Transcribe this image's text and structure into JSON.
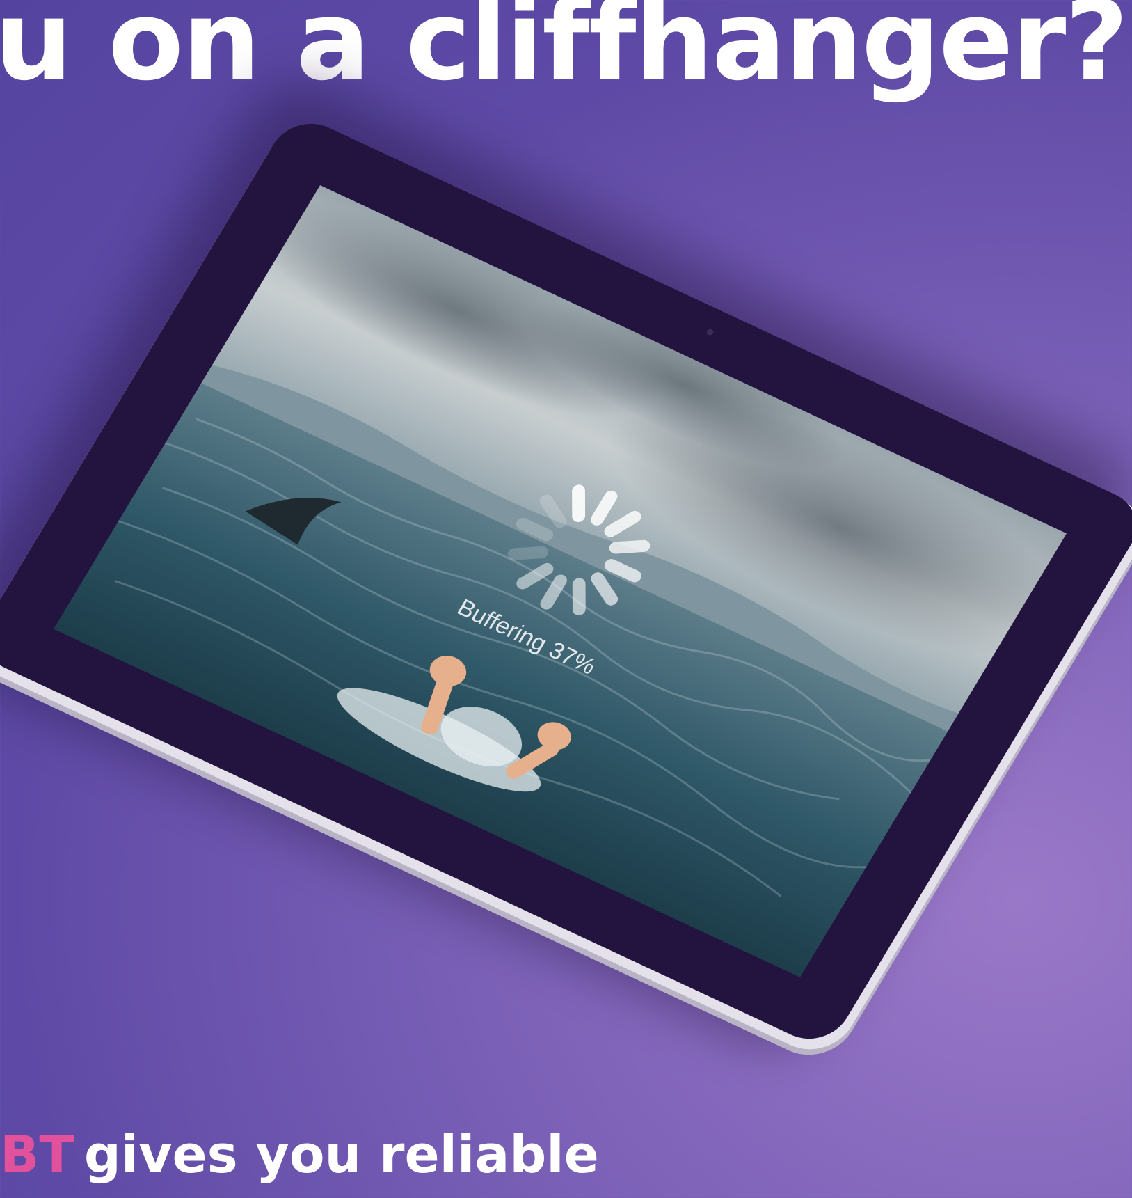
{
  "headline": {
    "text": "u on a cliffhanger?"
  },
  "tagline": {
    "brand": "BT",
    "text": "gives you reliable"
  },
  "tablet": {
    "buffering_label": "Buffering 37%",
    "buffering_percent": 37,
    "spinner_icon": "loading-spinner-icon",
    "scene_image": "sea-scene-with-shark-fin-and-drowning-hands"
  },
  "colors": {
    "brand": "#e2519c",
    "background": "#6a54ae",
    "tablet_bezel": "#23143f",
    "tablet_frame": "#e4e1ea",
    "text": "#ffffff"
  }
}
